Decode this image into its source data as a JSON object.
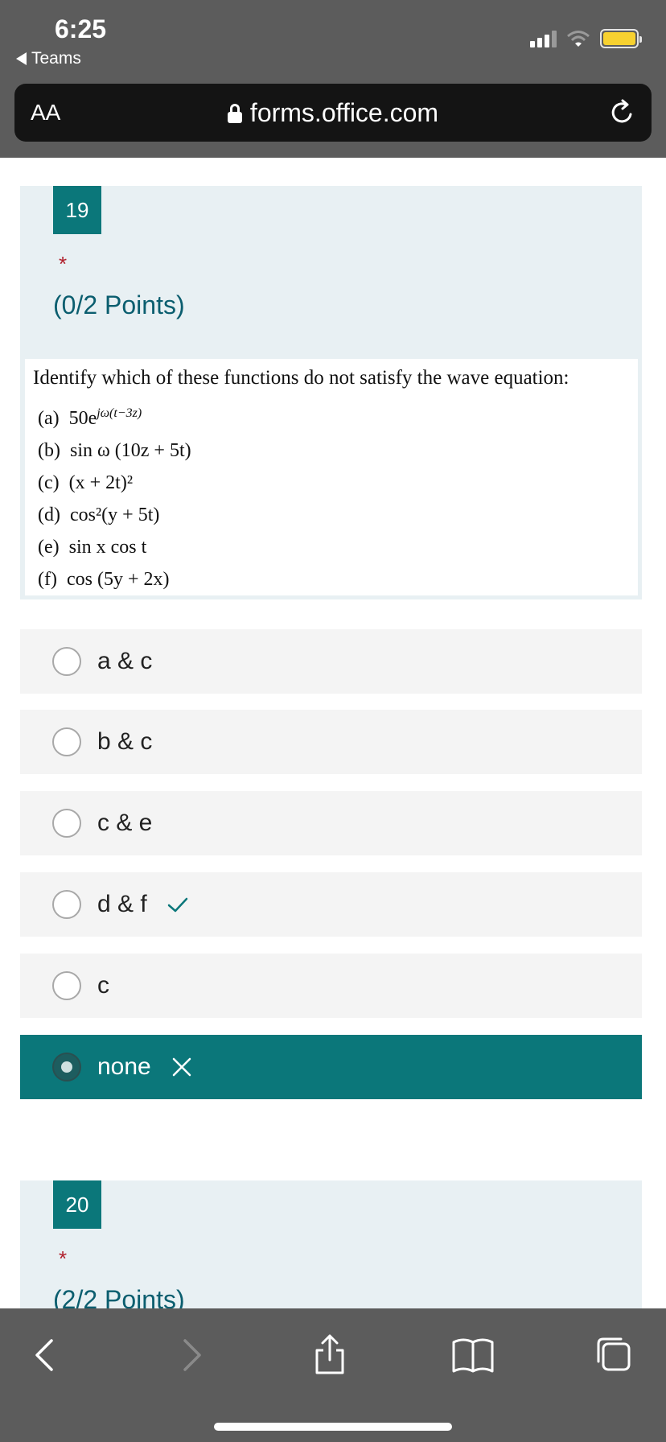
{
  "status_bar": {
    "time": "6:25",
    "back_app": "Teams"
  },
  "browser": {
    "text_size_label": "AA",
    "url": "forms.office.com"
  },
  "question19": {
    "number": "19",
    "required_mark": "*",
    "points": "(0/2 Points)",
    "prompt": "Identify which of these functions do not satisfy the wave equation:",
    "functions": [
      {
        "id": "(a)",
        "expr": "50e",
        "sup": "jω(t−3z)"
      },
      {
        "id": "(b)",
        "expr": "sin ω (10z + 5t)"
      },
      {
        "id": "(c)",
        "expr": "(x + 2t)²"
      },
      {
        "id": "(d)",
        "expr": "cos²(y + 5t)"
      },
      {
        "id": "(e)",
        "expr": "sin x cos t"
      },
      {
        "id": "(f)",
        "expr": "cos (5y + 2x)"
      }
    ],
    "options": [
      {
        "label": "a & c",
        "selected": false,
        "mark": ""
      },
      {
        "label": "b & c",
        "selected": false,
        "mark": ""
      },
      {
        "label": "c & e",
        "selected": false,
        "mark": ""
      },
      {
        "label": "d & f",
        "selected": false,
        "mark": "correct"
      },
      {
        "label": "c",
        "selected": false,
        "mark": ""
      },
      {
        "label": "none",
        "selected": true,
        "mark": "incorrect"
      }
    ]
  },
  "question20": {
    "number": "20",
    "required_mark": "*",
    "points": "(2/2 Points)"
  },
  "colors": {
    "accent": "#0b777a",
    "header_bg": "#e8f0f3",
    "chrome": "#5c5c5c",
    "required": "#b0202c"
  }
}
